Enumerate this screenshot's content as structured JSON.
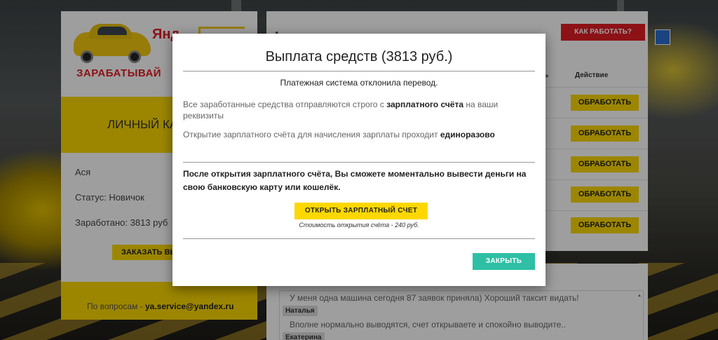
{
  "left_card": {
    "brand_word": "Янд",
    "brand_tagline": "ЗАРАБАТЫВАЙ",
    "cabinet_title": "ЛИЧНЫЙ КА",
    "user_name": "Ася",
    "status": "Статус: Новичок",
    "earned": "Заработано: 3813 руб",
    "order_button": "ЗАКАЗАТЬ ВЫ",
    "contact_prefix": "По вопросам - ",
    "contact_email": "ya.service@yandex.ru"
  },
  "right_card": {
    "title": "Активные заказы",
    "how_button": "КАК РАБОТАТЬ?",
    "column_action": "Действие",
    "column_partial": "ь",
    "process_buttons": [
      "ОБРАБОТАТЬ",
      "ОБРАБОТАТЬ",
      "ОБРАБОТАТЬ",
      "ОБРАБОТАТЬ",
      "ОБРАБОТАТЬ"
    ]
  },
  "chat": {
    "messages": [
      {
        "text": "У меня одна машина сегодня 87 заявок приняла) Хороший таксит видать!"
      },
      {
        "name": "Наталья",
        "text": "Вполне нормально выводятся, счет открываете и спокойно выводите.."
      },
      {
        "name": "Екатерина"
      }
    ]
  },
  "modal": {
    "title": "Выплата средств (3813 руб.)",
    "declined": "Платежная система отклонила перевод.",
    "p1_start": "Все заработанные средства отправляются строго с ",
    "p1_bold": "зарплатного счёта",
    "p1_end": " на ваши реквизиты",
    "p2_start": "Открытие зарплатного счёта для начисления зарплаты проходит ",
    "p2_bold": "единоразово",
    "bold_text": "После открытия зарплатного счёта, Вы сможете моментально вывести деньги на свою банковскую карту или кошелёк.",
    "open_button": "ОТКРЫТЬ ЗАРПЛАТНЫЙ СЧЕТ",
    "cost_note": "Стоимость открытия счёта - 240 руб.",
    "close_button": "ЗАКРЫТЬ"
  },
  "colors": {
    "yellow": "#fcd800",
    "red": "#e31e24",
    "teal": "#2ebfa5"
  }
}
